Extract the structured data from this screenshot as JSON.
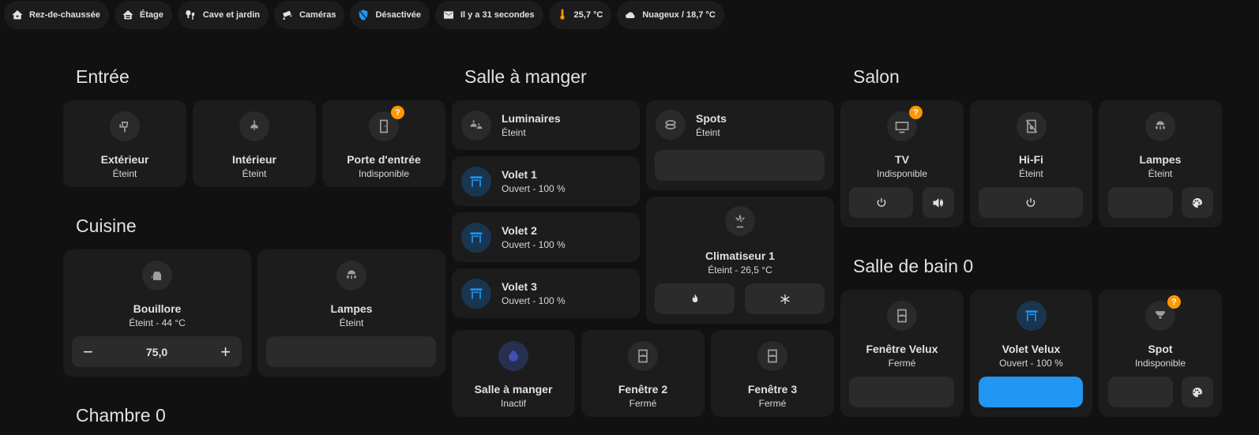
{
  "chips": [
    {
      "label": "Rez-de-chaussée",
      "icon": "home-floor-0-icon"
    },
    {
      "label": "Étage",
      "icon": "home-floor-1-icon"
    },
    {
      "label": "Cave et jardin",
      "icon": "tree-icon"
    },
    {
      "label": "Caméras",
      "icon": "cctv-icon"
    },
    {
      "label": "Désactivée",
      "icon": "shield-off-icon"
    },
    {
      "label": "Il y a 31 secondes",
      "icon": "email-icon"
    },
    {
      "label": "25,7 °C",
      "icon": "thermometer-icon"
    },
    {
      "label": "Nuageux / 18,7 °C",
      "icon": "cloudy-icon"
    }
  ],
  "sections": {
    "entree": "Entrée",
    "cuisine": "Cuisine",
    "chambre": "Chambre 0",
    "salle_a_manger": "Salle à manger",
    "salon": "Salon",
    "salle_de_bain": "Salle de bain 0"
  },
  "entree": [
    {
      "name": "Extérieur",
      "state": "Éteint",
      "icon": "outdoor-lamp-icon"
    },
    {
      "name": "Intérieur",
      "state": "Éteint",
      "icon": "ceiling-light-icon"
    },
    {
      "name": "Porte d'entrée",
      "state": "Indisponible",
      "icon": "door-icon",
      "badge": "?"
    }
  ],
  "cuisine": {
    "bouilloire": {
      "name": "Bouillore",
      "state": "Éteint - 44 °C",
      "value": "75,0",
      "minus": "−",
      "plus": "+",
      "icon": "kettle-icon"
    },
    "lampes": {
      "name": "Lampes",
      "state": "Éteint",
      "icon": "lamps-icon"
    }
  },
  "salle_a_manger": {
    "luminaires": {
      "name": "Luminaires",
      "state": "Éteint",
      "icon": "ceiling-lights-icon"
    },
    "spots": {
      "name": "Spots",
      "state": "Éteint",
      "icon": "spotlights-icon"
    },
    "volets": [
      {
        "name": "Volet 1",
        "state": "Ouvert - 100 %",
        "icon": "shutter-open-icon"
      },
      {
        "name": "Volet 2",
        "state": "Ouvert - 100 %",
        "icon": "shutter-open-icon"
      },
      {
        "name": "Volet 3",
        "state": "Ouvert - 100 %",
        "icon": "shutter-open-icon"
      }
    ],
    "clim": {
      "name": "Climatiseur 1",
      "state": "Éteint - 26,5 °C",
      "icon": "air-conditioner-icon"
    },
    "bottom": [
      {
        "name": "Salle à manger",
        "state": "Inactif",
        "icon": "media-player-icon"
      },
      {
        "name": "Fenêtre 2",
        "state": "Fermé",
        "icon": "window-closed-icon"
      },
      {
        "name": "Fenêtre 3",
        "state": "Fermé",
        "icon": "window-closed-icon"
      }
    ]
  },
  "salon": [
    {
      "name": "TV",
      "state": "Indisponible",
      "icon": "tv-icon",
      "badge": "?"
    },
    {
      "name": "Hi-Fi",
      "state": "Éteint",
      "icon": "speaker-off-icon"
    },
    {
      "name": "Lampes",
      "state": "Éteint",
      "icon": "lamps-icon"
    }
  ],
  "salle_de_bain": [
    {
      "name": "Fenêtre Velux",
      "state": "Fermé",
      "icon": "window-closed-icon"
    },
    {
      "name": "Volet Velux",
      "state": "Ouvert - 100 %",
      "icon": "shutter-open-icon"
    },
    {
      "name": "Spot",
      "state": "Indisponible",
      "icon": "spotlight-icon",
      "badge": "?"
    }
  ],
  "colors": {
    "background": "#111111",
    "card": "#1c1c1c",
    "control": "#2b2b2b",
    "accent_blue": "#2196f3",
    "badge_orange": "#ff9800"
  }
}
